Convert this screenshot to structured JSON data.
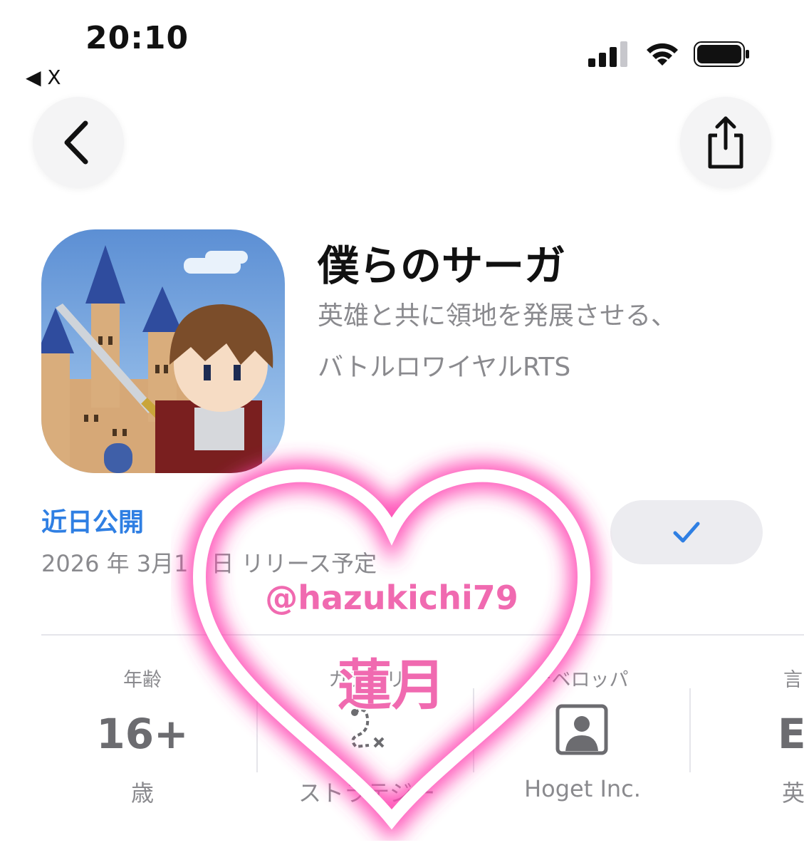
{
  "status_bar": {
    "time": "20:10",
    "back_to_app": "◀ X",
    "signal_icon": "cellular-signal-icon",
    "wifi_icon": "wifi-icon",
    "battery_icon": "battery-icon"
  },
  "nav": {
    "back_icon": "chevron-left-icon",
    "share_icon": "share-icon"
  },
  "app": {
    "name": "僕らのサーガ",
    "subtitle_line1": "英雄と共に領地を発展させる、",
    "subtitle_line2": "バトルロワイヤルRTS",
    "status": "近日公開",
    "release": "2026 年 3月1　日 リリース予定",
    "notify_icon": "checkmark-icon"
  },
  "info": {
    "age_label": "年齢",
    "age_value": "16+",
    "age_sub": "歳",
    "category_label": "カテゴリ",
    "category_icon": "strategy-icon",
    "category_sub": "ストラテジー",
    "developer_label": "デベロッパ",
    "developer_icon": "person-icon",
    "developer_sub": "Hoget Inc.",
    "language_label": "言",
    "language_value": "E",
    "language_sub": "英"
  },
  "watermark": {
    "handle": "@hazukichi79",
    "name": "蓮月"
  },
  "colors": {
    "accent_blue": "#2f7fe3",
    "watermark_pink": "#f06ab0",
    "secondary_text": "#8a8a8e"
  }
}
